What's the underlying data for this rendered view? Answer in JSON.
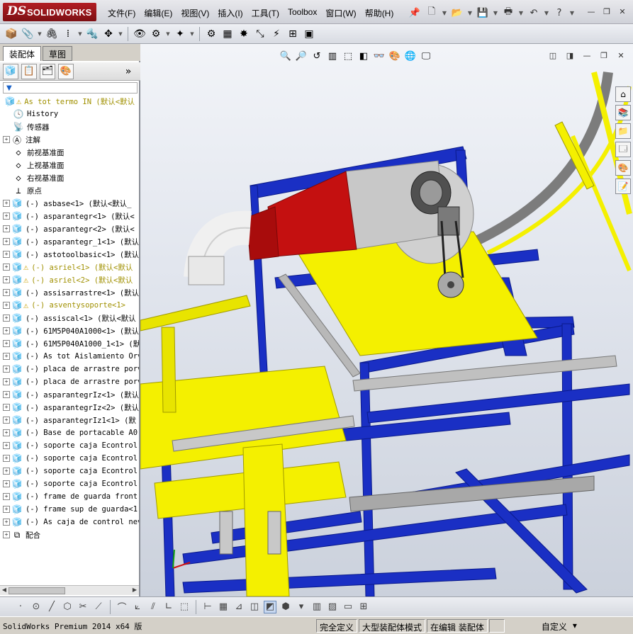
{
  "app": {
    "logo_ds": "DS",
    "logo_name": "SOLIDWORKS"
  },
  "menu": [
    "文件(F)",
    "编辑(E)",
    "视图(V)",
    "插入(I)",
    "工具(T)",
    "Toolbox",
    "窗口(W)",
    "帮助(H)"
  ],
  "tabs": {
    "assembly": "装配体",
    "sketch": "草图"
  },
  "tree": [
    {
      "label": "As tot termo IN  (默认<默认",
      "icon": "assembly-icon",
      "warn": true,
      "yellow": true,
      "exp": "none"
    },
    {
      "label": "History",
      "icon": "history-icon",
      "exp": "none"
    },
    {
      "label": "传感器",
      "icon": "sensor-icon",
      "exp": "none"
    },
    {
      "label": "注解",
      "icon": "annotation-icon",
      "exp": "+"
    },
    {
      "label": "前视基准面",
      "icon": "plane-icon",
      "exp": "none"
    },
    {
      "label": "上视基准面",
      "icon": "plane-icon",
      "exp": "none"
    },
    {
      "label": "右视基准面",
      "icon": "plane-icon",
      "exp": "none"
    },
    {
      "label": "原点",
      "icon": "origin-icon",
      "exp": "none"
    },
    {
      "label": "(-) asbase<1> (默认<默认_",
      "icon": "subassembly-icon",
      "exp": "+"
    },
    {
      "label": "(-) asparantegr<1> (默认<",
      "icon": "subassembly-icon",
      "exp": "+"
    },
    {
      "label": "(-) asparantegr<2> (默认<",
      "icon": "subassembly-icon",
      "exp": "+"
    },
    {
      "label": "(-) asparantegr_1<1> (默认",
      "icon": "subassembly-icon",
      "exp": "+"
    },
    {
      "label": "(-) astotoolbasic<1> (默认",
      "icon": "subassembly-icon",
      "exp": "+"
    },
    {
      "label": "(-) asriel<1> (默认<默认",
      "icon": "subassembly-icon",
      "warn": true,
      "yellow": true,
      "exp": "+"
    },
    {
      "label": "(-) asriel<2> (默认<默认",
      "icon": "subassembly-icon",
      "warn": true,
      "yellow": true,
      "exp": "+"
    },
    {
      "label": "(-) assisarrastre<1> (默认",
      "icon": "subassembly-icon",
      "exp": "+"
    },
    {
      "label": "(-) asventysoporte<1>",
      "icon": "subassembly-icon",
      "warn": true,
      "yellow": true,
      "exp": "+"
    },
    {
      "label": "(-) assiscal<1> (默认<默认",
      "icon": "subassembly-icon",
      "exp": "+"
    },
    {
      "label": "(-) 61M5P040A1000<1> (默认",
      "icon": "subassembly-icon",
      "exp": "+"
    },
    {
      "label": "(-) 61M5P040A1000_1<1> (默",
      "icon": "subassembly-icon",
      "exp": "+"
    },
    {
      "label": "(-) As tot Aislamiento Orv",
      "icon": "subassembly-icon",
      "exp": "+"
    },
    {
      "label": "(-) placa de arrastre porv",
      "icon": "subassembly-icon",
      "exp": "+"
    },
    {
      "label": "(-) placa de arrastre porv",
      "icon": "subassembly-icon",
      "exp": "+"
    },
    {
      "label": "(-) asparantegrIz<1> (默认",
      "icon": "subassembly-icon",
      "exp": "+"
    },
    {
      "label": "(-) asparantegrIz<2> (默认",
      "icon": "subassembly-icon",
      "exp": "+"
    },
    {
      "label": "(-) asparantegrIz1<1> (默",
      "icon": "subassembly-icon",
      "exp": "+"
    },
    {
      "label": "(-) Base de portacable A0",
      "icon": "subassembly-icon",
      "exp": "+"
    },
    {
      "label": "(-) soporte caja Econtrol",
      "icon": "subassembly-icon",
      "exp": "+"
    },
    {
      "label": "(-) soporte caja Econtrol",
      "icon": "subassembly-icon",
      "exp": "+"
    },
    {
      "label": "(-) soporte caja Econtrol",
      "icon": "subassembly-icon",
      "exp": "+"
    },
    {
      "label": "(-) soporte caja Econtrol",
      "icon": "subassembly-icon",
      "exp": "+"
    },
    {
      "label": "(-) frame de guarda front",
      "icon": "subassembly-icon",
      "exp": "+"
    },
    {
      "label": "(-) frame sup de guarda<1",
      "icon": "subassembly-icon",
      "exp": "+"
    },
    {
      "label": "(-) As caja de control nev",
      "icon": "subassembly-icon",
      "exp": "+"
    },
    {
      "label": "配合",
      "icon": "mates-icon",
      "exp": "+"
    }
  ],
  "status": {
    "product": "SolidWorks Premium 2014 x64 版",
    "definition": "完全定义",
    "mode": "大型装配体模式",
    "editing": "在编辑 装配体",
    "custom": "自定义"
  },
  "colors": {
    "frame_blue": "#1a2fc4",
    "yellow": "#f4f000",
    "red_duct": "#c41010",
    "grey": "#b8b8b8"
  }
}
